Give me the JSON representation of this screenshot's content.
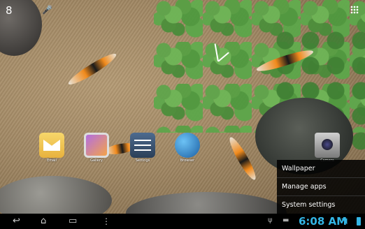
{
  "status": {
    "notification_count": "8"
  },
  "apps": [
    {
      "name": "Email"
    },
    {
      "name": "Gallery"
    },
    {
      "name": "Settings"
    },
    {
      "name": "Browser"
    },
    {
      "name": "Camera"
    }
  ],
  "menu": {
    "items": [
      {
        "label": "Wallpaper"
      },
      {
        "label": "Manage apps"
      },
      {
        "label": "System settings"
      }
    ]
  },
  "navbar": {
    "time": "6:08 AM",
    "icons": [
      "back-icon",
      "home-icon",
      "recent-apps-icon",
      "menu-dots-icon",
      "usb-icon",
      "message-icon",
      "wifi-icon",
      "battery-icon"
    ]
  },
  "colors": {
    "accent": "#33b5e5",
    "menu_bg": "#000000"
  }
}
